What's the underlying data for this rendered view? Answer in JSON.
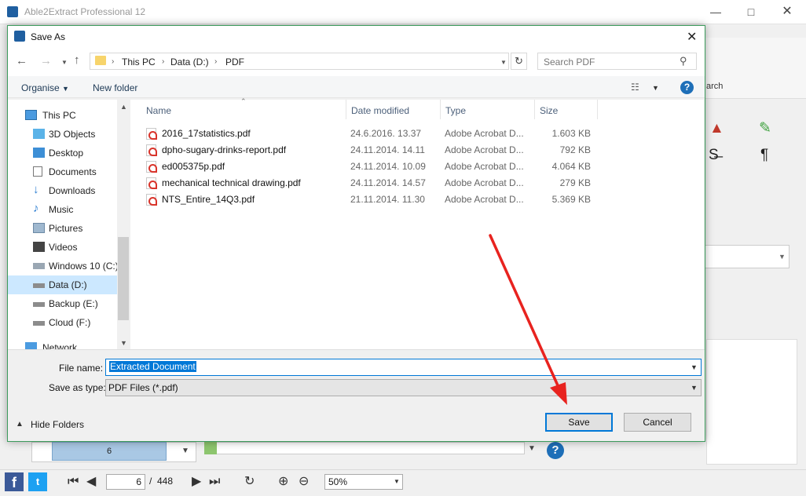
{
  "app": {
    "title": "Able2Extract Professional 12",
    "ribbon_search_label": "arch",
    "thumbnail_page": "6",
    "current_page": "6",
    "page_separator": "/",
    "total_pages": "448",
    "zoom": "50%",
    "icons": [
      "facebook-icon",
      "twitter-icon",
      "first-page-icon",
      "prev-page-icon",
      "next-page-icon",
      "last-page-icon",
      "rotate-icon",
      "zoom-in-icon",
      "zoom-out-icon",
      "stamp-icon",
      "highlight-icon",
      "strikethrough-icon",
      "pilcrow-icon",
      "help-icon"
    ]
  },
  "dialog": {
    "title": "Save As",
    "address": {
      "crumbs": [
        "This PC",
        "Data (D:)",
        "PDF"
      ]
    },
    "search_placeholder": "Search PDF",
    "toolbar": {
      "organise": "Organise",
      "new_folder": "New folder"
    },
    "nav_items": [
      {
        "label": "This PC",
        "icon": "computer-icon"
      },
      {
        "label": "3D Objects",
        "icon": "cube-icon"
      },
      {
        "label": "Desktop",
        "icon": "desktop-icon"
      },
      {
        "label": "Documents",
        "icon": "documents-icon"
      },
      {
        "label": "Downloads",
        "icon": "download-icon"
      },
      {
        "label": "Music",
        "icon": "music-icon"
      },
      {
        "label": "Pictures",
        "icon": "pictures-icon"
      },
      {
        "label": "Videos",
        "icon": "videos-icon"
      },
      {
        "label": "Windows 10 (C:)",
        "icon": "drive-icon"
      },
      {
        "label": "Data (D:)",
        "icon": "drive-icon",
        "selected": true
      },
      {
        "label": "Backup (E:)",
        "icon": "drive-icon"
      },
      {
        "label": "Cloud (F:)",
        "icon": "drive-icon"
      },
      {
        "label": "Network",
        "icon": "network-icon"
      }
    ],
    "columns": {
      "name": "Name",
      "date": "Date modified",
      "type": "Type",
      "size": "Size"
    },
    "files": [
      {
        "name": "2016_17statistics.pdf",
        "date": "24.6.2016. 13.37",
        "type": "Adobe Acrobat D...",
        "size": "1.603 KB"
      },
      {
        "name": "dpho-sugary-drinks-report.pdf",
        "date": "24.11.2014. 14.11",
        "type": "Adobe Acrobat D...",
        "size": "792 KB"
      },
      {
        "name": "ed005375p.pdf",
        "date": "24.11.2014. 10.09",
        "type": "Adobe Acrobat D...",
        "size": "4.064 KB"
      },
      {
        "name": "mechanical technical drawing.pdf",
        "date": "24.11.2014. 14.57",
        "type": "Adobe Acrobat D...",
        "size": "279 KB"
      },
      {
        "name": "NTS_Entire_14Q3.pdf",
        "date": "21.11.2014. 11.30",
        "type": "Adobe Acrobat D...",
        "size": "5.369 KB"
      }
    ],
    "file_name_label": "File name:",
    "file_name_value": "Extracted Document",
    "save_type_label": "Save as type:",
    "save_type_value": "PDF Files (*.pdf)",
    "hide_folders": "Hide Folders",
    "save_button": "Save",
    "cancel_button": "Cancel"
  },
  "colors": {
    "accent": "#0078d7",
    "selection": "#cce8ff",
    "annotation": "#e8231f"
  }
}
